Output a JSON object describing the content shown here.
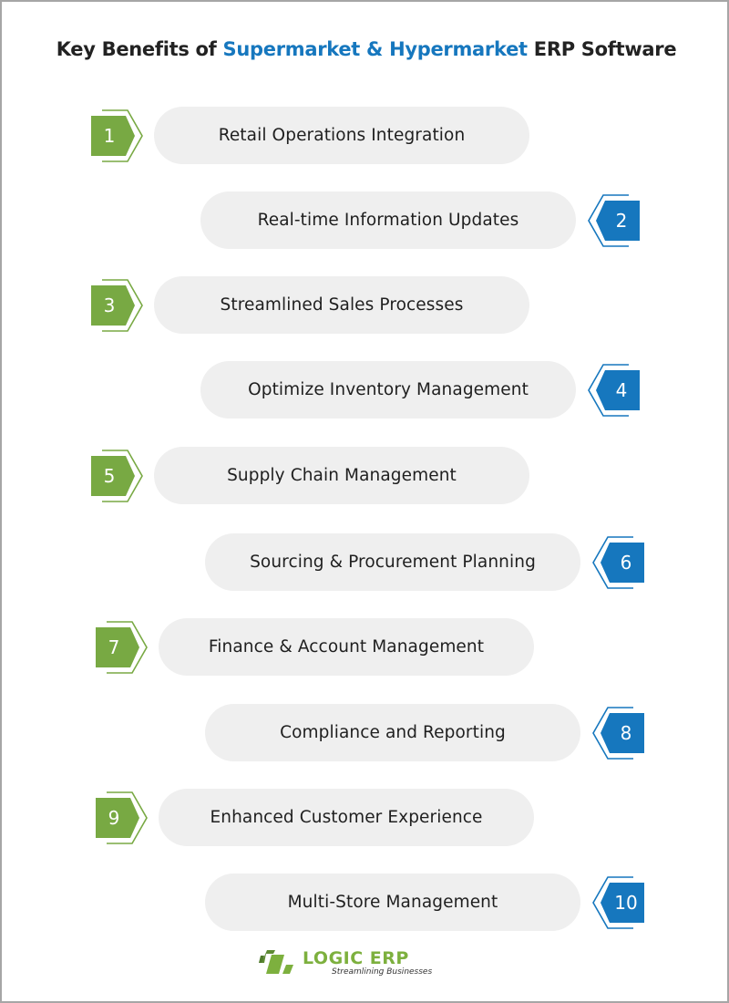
{
  "title": {
    "prefix": "Key Benefits of ",
    "highlight": "Supermarket & Hypermarket",
    "suffix": " ERP Software"
  },
  "colors": {
    "accent_blue": "#1677be",
    "accent_green": "#78a943",
    "pill_bg": "#efefef",
    "text": "#222222",
    "border": "#a6a6a6"
  },
  "benefits": [
    {
      "number": "1",
      "label": "Retail Operations Integration",
      "side": "left",
      "color": "green"
    },
    {
      "number": "2",
      "label": "Real-time Information Updates",
      "side": "right",
      "color": "blue"
    },
    {
      "number": "3",
      "label": "Streamlined Sales Processes",
      "side": "left",
      "color": "green"
    },
    {
      "number": "4",
      "label": "Optimize Inventory Management",
      "side": "right",
      "color": "blue"
    },
    {
      "number": "5",
      "label": "Supply Chain Management",
      "side": "left",
      "color": "green"
    },
    {
      "number": "6",
      "label": "Sourcing & Procurement Planning",
      "side": "right",
      "color": "blue"
    },
    {
      "number": "7",
      "label": "Finance & Account Management",
      "side": "left",
      "color": "green"
    },
    {
      "number": "8",
      "label": "Compliance and Reporting",
      "side": "right",
      "color": "blue"
    },
    {
      "number": "9",
      "label": "Enhanced Customer Experience",
      "side": "left",
      "color": "green"
    },
    {
      "number": "10",
      "label": "Multi-Store Management",
      "side": "right",
      "color": "blue"
    }
  ],
  "logo": {
    "icon": "logic-erp-logo-icon",
    "brand": "LOGIC ERP",
    "tagline": "Streamlining Businesses"
  }
}
